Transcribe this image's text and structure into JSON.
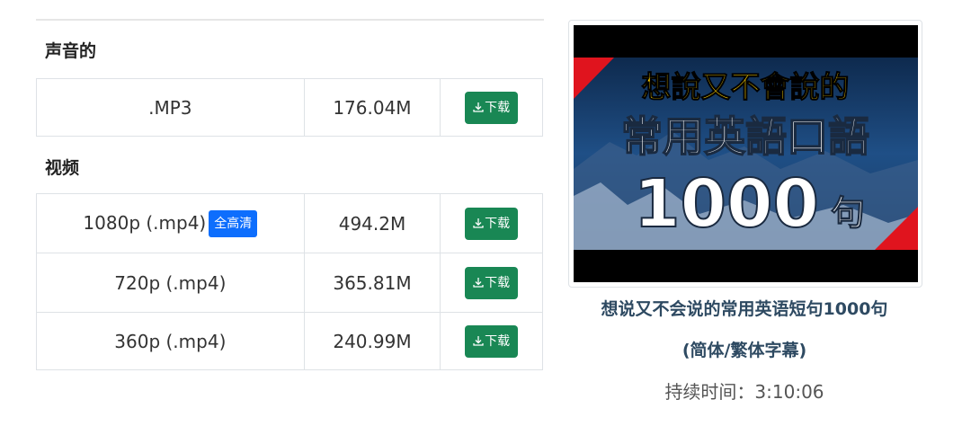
{
  "audio_section": {
    "title": "声音的",
    "rows": [
      {
        "format": ".MP3",
        "size": "176.04M",
        "button": "下载"
      }
    ]
  },
  "video_section": {
    "title": "视频",
    "rows": [
      {
        "format": "1080p (.mp4)",
        "badge": "全高清",
        "size": "494.2M",
        "button": "下载"
      },
      {
        "format": "720p (.mp4)",
        "size": "365.81M",
        "button": "下载"
      },
      {
        "format": "360p (.mp4)",
        "size": "240.99M",
        "button": "下载"
      }
    ]
  },
  "thumbnail": {
    "line1": "想說又不會說的",
    "line2": "常用英語口語",
    "number": "1000",
    "unit": "句"
  },
  "video_info": {
    "title_line1": "想说又不会说的常用英语短句1000句",
    "title_line2": "(简体/繁体字幕)",
    "duration": "持续时间：3:10:06"
  },
  "colors": {
    "download_button": "#198754",
    "badge": "#0d6efd",
    "title_text": "#2e4a62",
    "thumb_yellow": "#ffd200",
    "thumb_red": "#e0141e"
  },
  "icons": {
    "download": "download-icon"
  }
}
